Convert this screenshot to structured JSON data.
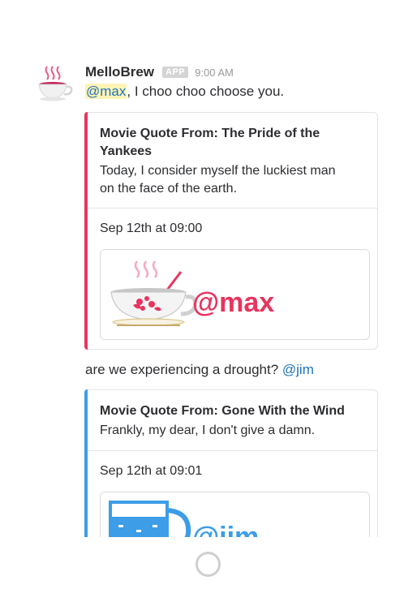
{
  "message": {
    "sender": "MelloBrew",
    "badge": "APP",
    "time": "9:00 AM",
    "line1_mention": "@max",
    "line1_text": ", I choo choo choose you.",
    "line2_text": "are we experiencing a drought? ",
    "line2_mention": "@jim"
  },
  "attachments": [
    {
      "title_1": "Movie Quote From: The Pride of the",
      "title_2": "Yankees",
      "text_1": "Today, I consider myself the luckiest man",
      "text_2": "on the face of the earth.",
      "date": "Sep 12th at 09:00",
      "image_label": "@max",
      "color": "#e8345e"
    },
    {
      "title_1": "Movie Quote From: Gone With the Wind",
      "text_1": "Frankly, my dear, I don't give a damn.",
      "date": "Sep 12th at 09:01",
      "image_label": "@jim",
      "color": "#3d9de6"
    }
  ],
  "colors": {
    "mention": "#1d75b8",
    "mention_bg": "#fff3b6",
    "max_accent": "#e8345e",
    "jim_accent": "#3d9de6"
  },
  "icons": {
    "avatar": "teacup-icon",
    "loading": "loading-spinner-icon"
  }
}
